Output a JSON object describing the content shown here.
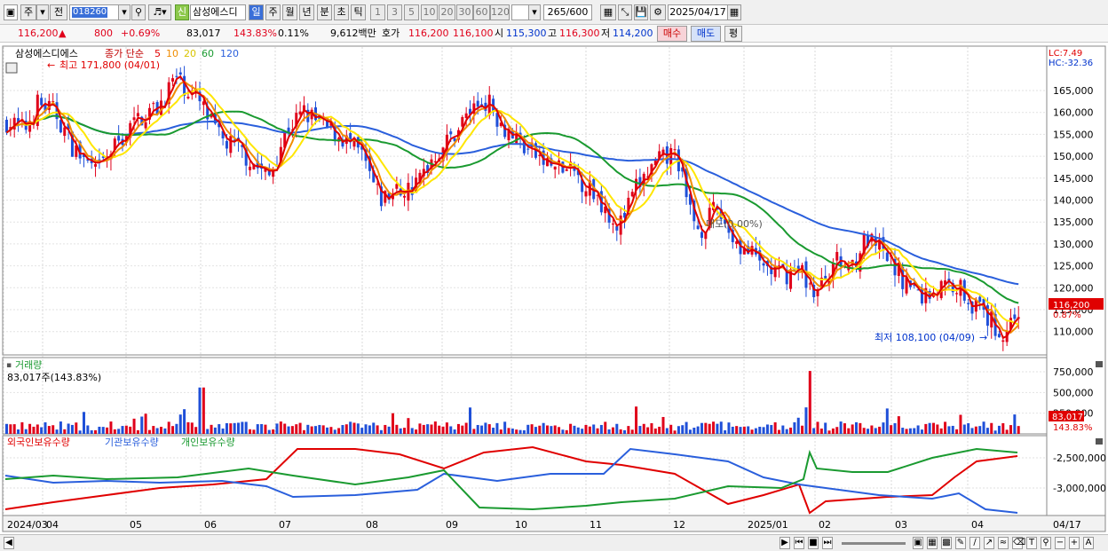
{
  "toolbar": {
    "market": "주",
    "prev": "전",
    "code": "018260",
    "stock_name": "삼성에스디",
    "new_badge": "신",
    "periods": [
      "일",
      "주",
      "월",
      "년",
      "분",
      "초",
      "틱"
    ],
    "active_period": "일",
    "intervals": [
      "1",
      "3",
      "5",
      "10",
      "20",
      "30",
      "60",
      "120"
    ],
    "count_display": "265/600",
    "date": "2025/04/17"
  },
  "quote": {
    "price": "116,200",
    "change": "800",
    "change_pct": "+0.69%",
    "volume": "83,017",
    "vol_ratio": "143.83%",
    "turnover": "0.11%",
    "amount": "9,612백만",
    "bid_label": "호가",
    "ask": "116,200",
    "bid": "116,100",
    "open_label": "시",
    "open": "115,300",
    "high_label": "고",
    "high": "116,300",
    "low_label": "저",
    "low": "114,200",
    "buy_btn": "매수",
    "sell_btn": "매도",
    "eval_btn": "평"
  },
  "colors": {
    "up": "#e0001a",
    "down": "#1f4fd8",
    "ma5": "#e00000",
    "ma10": "#f08c00",
    "ma20": "#ffe600",
    "ma60": "#1a9a30",
    "ma120": "#2a5fdc"
  },
  "price_panel": {
    "title": "삼성에스디에스",
    "ma_label": "종가 단순",
    "ma_periods": [
      "5",
      "10",
      "20",
      "60",
      "120"
    ],
    "hi_annot": "최고 171,800 (04/01)",
    "lo_annot": "최저 108,100 (04/09)",
    "mid_annot": "매도(0.00%)",
    "lc": "LC:7.49",
    "hc": "HC:-32.36",
    "last_price": "116,200",
    "last_pct": "0.87%",
    "yaxis": [
      "165,000",
      "160,000",
      "155,000",
      "150,000",
      "145,000",
      "140,000",
      "135,000",
      "130,000",
      "125,000",
      "120,000",
      "115,000",
      "110,000"
    ]
  },
  "volume_panel": {
    "title": "거래량",
    "value": "83,017주(143.83%)",
    "yaxis": [
      "750,000",
      "500,000",
      "250,000"
    ],
    "last_value": "83,017",
    "last_pct": "143.83%"
  },
  "holdings_panel": {
    "legend": [
      "외국인보유수량",
      "기관보유수량",
      "개인보유수량"
    ],
    "yaxis": [
      "-2,500,000",
      "-3,000,000"
    ]
  },
  "xaxis": [
    "2024/03",
    "04",
    "05",
    "06",
    "07",
    "08",
    "09",
    "10",
    "11",
    "12",
    "2025/01",
    "02",
    "03",
    "04"
  ],
  "xaxis_last": "04/17"
}
